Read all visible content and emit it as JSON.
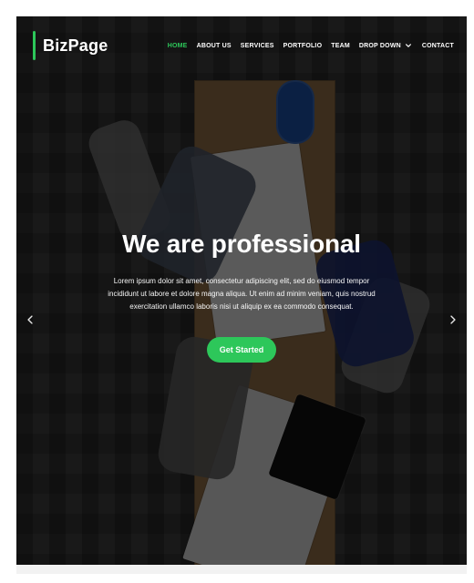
{
  "brand": {
    "name": "BizPage"
  },
  "nav": {
    "items": [
      {
        "label": "HOME",
        "active": true
      },
      {
        "label": "ABOUT US",
        "active": false
      },
      {
        "label": "SERVICES",
        "active": false
      },
      {
        "label": "PORTFOLIO",
        "active": false
      },
      {
        "label": "TEAM",
        "active": false
      },
      {
        "label": "DROP DOWN",
        "active": false,
        "has_dropdown": true
      },
      {
        "label": "CONTACT",
        "active": false
      }
    ]
  },
  "hero": {
    "title": "We are professional",
    "body": "Lorem ipsum dolor sit amet, consectetur adipiscing elit, sed do eiusmod tempor incididunt ut labore et dolore magna aliqua. Ut enim ad minim veniam, quis nostrud exercitation ullamco laboris nisi ut aliquip ex ea commodo consequat.",
    "cta_label": "Get Started"
  },
  "ui": {
    "icons": {
      "prev": "chevron-left-icon",
      "next": "chevron-right-icon",
      "dropdown": "chevron-down-icon"
    },
    "colors": {
      "accent": "#2dc75a",
      "text": "#ffffff"
    }
  }
}
